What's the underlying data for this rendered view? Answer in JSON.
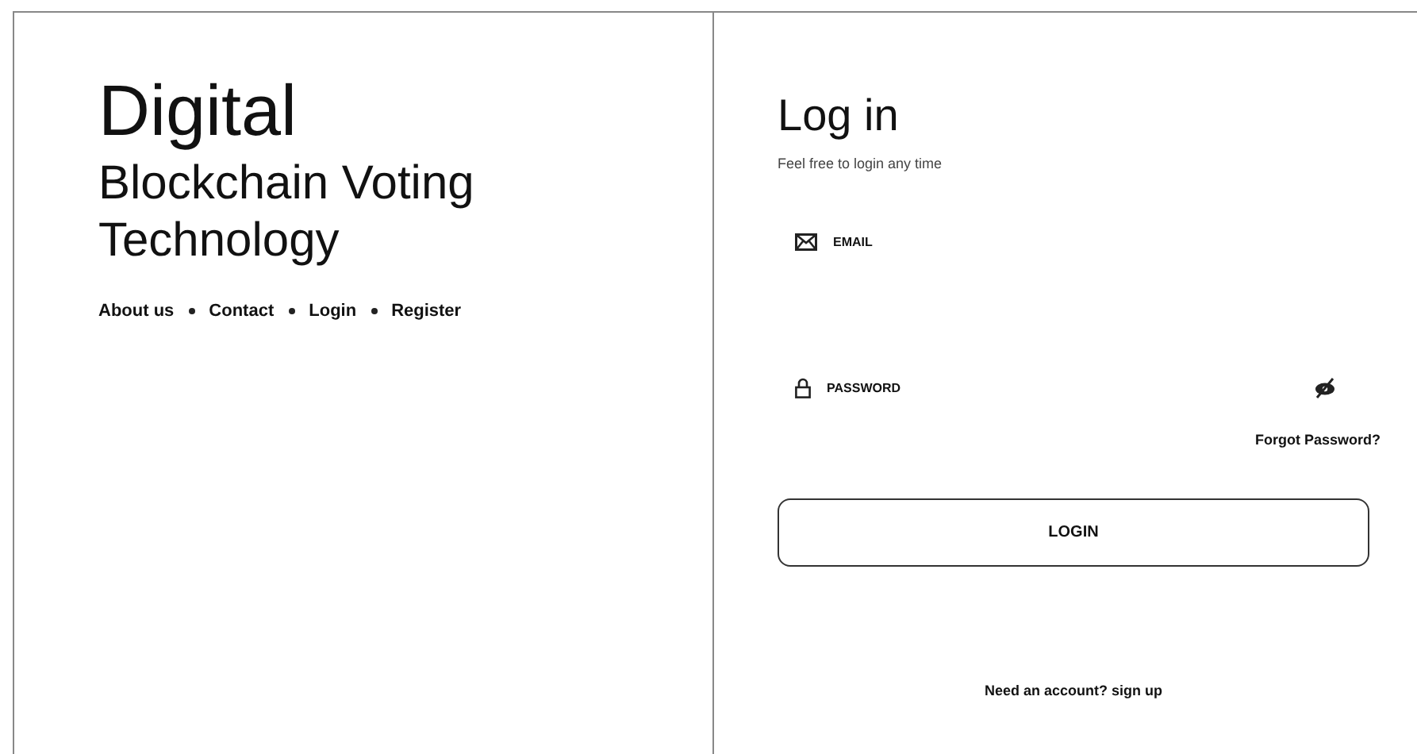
{
  "brand": {
    "title": "Digital",
    "subtitle": "Blockchain Voting Technology"
  },
  "nav": [
    "About us",
    "Contact",
    "Login",
    "Register"
  ],
  "login": {
    "title": "Log in",
    "subtitle": "Feel free to login any time",
    "fields": [
      {
        "kind": "email",
        "label": "EMAIL"
      },
      {
        "kind": "password",
        "label": "PASSWORD"
      }
    ],
    "forgot": "Forgot Password?",
    "button": "LOGIN",
    "signup": "Need an account? sign up"
  }
}
